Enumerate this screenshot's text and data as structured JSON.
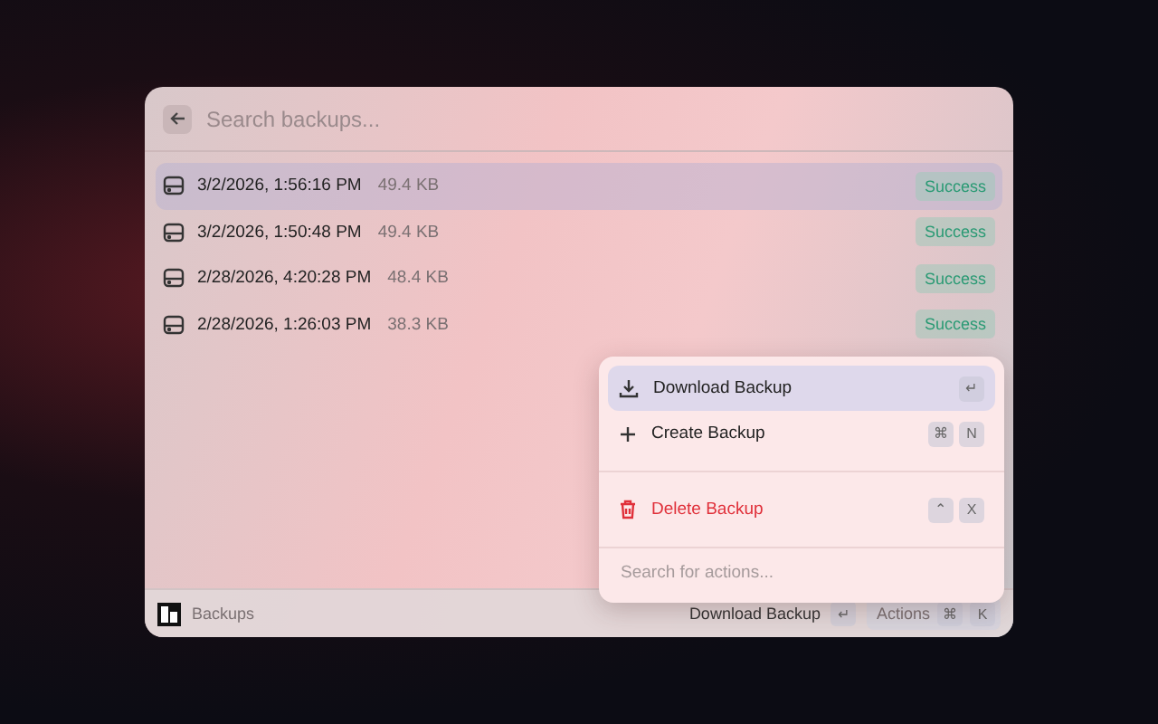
{
  "search": {
    "placeholder": "Search backups..."
  },
  "backups": [
    {
      "date": "3/2/2026, 1:56:16 PM",
      "size": "49.4 KB",
      "status": "Success",
      "selected": true
    },
    {
      "date": "3/2/2026, 1:50:48 PM",
      "size": "49.4 KB",
      "status": "Success",
      "selected": false
    },
    {
      "date": "2/28/2026, 4:20:28 PM",
      "size": "48.4 KB",
      "status": "Success",
      "selected": false
    },
    {
      "date": "2/28/2026, 1:26:03 PM",
      "size": "38.3 KB",
      "status": "Success",
      "selected": false
    }
  ],
  "action_menu": {
    "groups": [
      [
        {
          "kind": "download",
          "label": "Download Backup",
          "keys": [
            "↵"
          ],
          "selected": true
        },
        {
          "kind": "create",
          "label": "Create Backup",
          "keys": [
            "⌘",
            "N"
          ],
          "selected": false
        }
      ],
      [
        {
          "kind": "delete",
          "label": "Delete Backup",
          "keys": [
            "⌃",
            "X"
          ],
          "selected": false
        }
      ]
    ],
    "search": {
      "placeholder": "Search for actions..."
    }
  },
  "footer": {
    "title": "Backups",
    "primary_action": "Download Backup",
    "primary_keys": [
      "↵"
    ],
    "actions_label": "Actions",
    "actions_keys": [
      "⌘",
      "K"
    ]
  }
}
